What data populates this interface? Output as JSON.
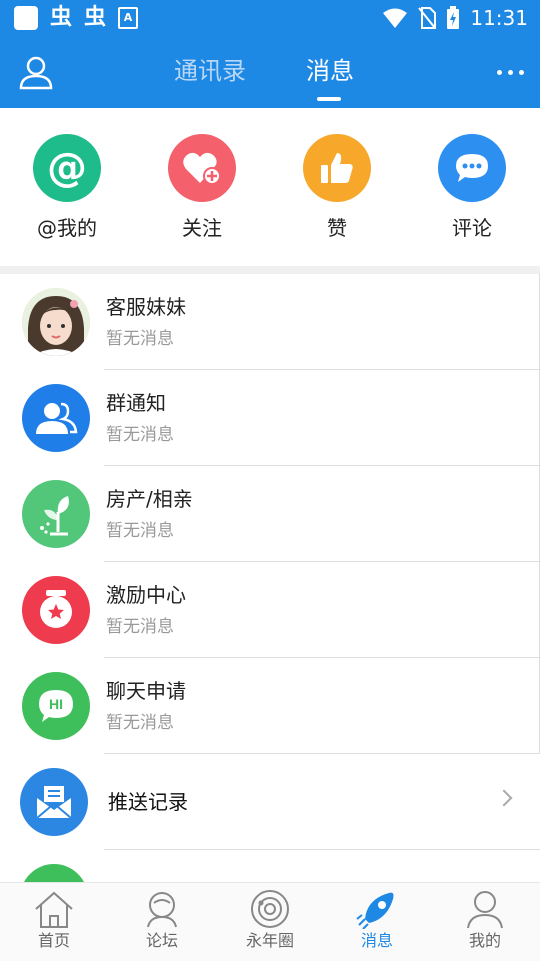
{
  "status_bar": {
    "time": "11:31",
    "app_glyph_1": "虫",
    "app_glyph_2": "虫",
    "small_badge": "A"
  },
  "header": {
    "tabs": [
      {
        "label": "通讯录"
      },
      {
        "label": "消息"
      }
    ]
  },
  "quick_actions": [
    {
      "label": "@我的",
      "icon": "at-icon",
      "color": "#1ebc8a"
    },
    {
      "label": "关注",
      "icon": "heart-plus-icon",
      "color": "#f4606c"
    },
    {
      "label": "赞",
      "icon": "thumbs-up-icon",
      "color": "#f7a72a"
    },
    {
      "label": "评论",
      "icon": "comment-icon",
      "color": "#2d8ff0"
    }
  ],
  "messages": [
    {
      "title": "客服妹妹",
      "subtitle": "暂无消息",
      "avatar": "customer-service-avatar"
    },
    {
      "title": "群通知",
      "subtitle": "暂无消息",
      "avatar": "group-icon",
      "color": "#1f7ee8"
    },
    {
      "title": "房产/相亲",
      "subtitle": "暂无消息",
      "avatar": "sprout-icon",
      "color": "#52c77a"
    },
    {
      "title": "激励中心",
      "subtitle": "暂无消息",
      "avatar": "medal-icon",
      "color": "#ee3b4d"
    },
    {
      "title": "聊天申请",
      "subtitle": "暂无消息",
      "avatar": "hi-chat-icon",
      "color": "#3fbf5b"
    }
  ],
  "push_record": {
    "title": "推送记录",
    "icon": "mail-open-icon",
    "color": "#2c87e3"
  },
  "tabbar": [
    {
      "label": "首页",
      "icon": "home-icon"
    },
    {
      "label": "论坛",
      "icon": "forum-icon"
    },
    {
      "label": "永年圈",
      "icon": "planet-icon"
    },
    {
      "label": "消息",
      "icon": "rocket-icon",
      "active": true
    },
    {
      "label": "我的",
      "icon": "profile-icon"
    }
  ]
}
